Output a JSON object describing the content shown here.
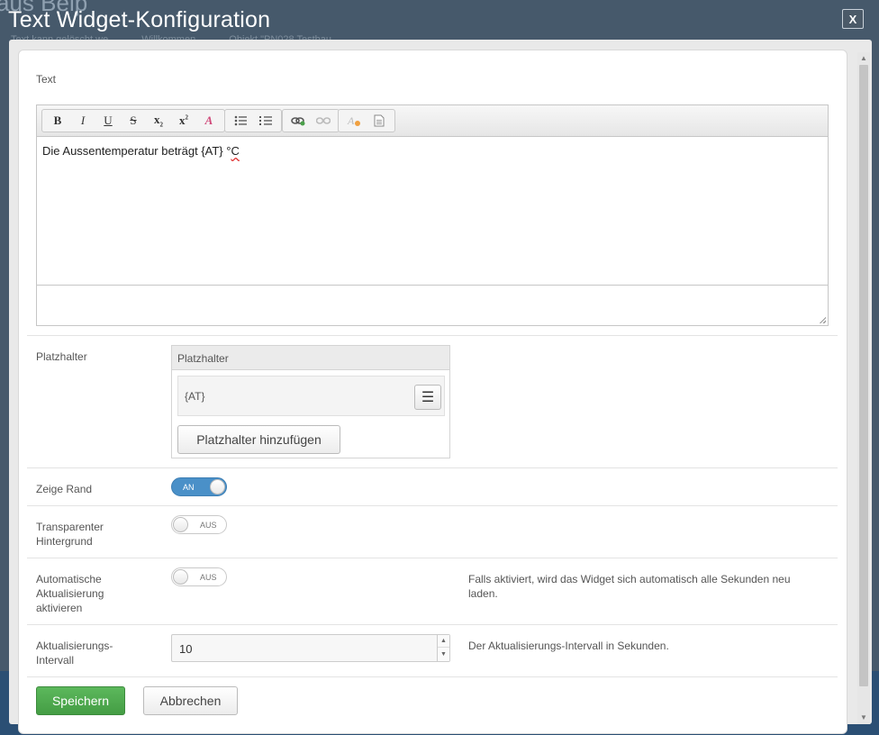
{
  "background": {
    "title": "aus Belp\"",
    "nav": [
      "Text kann gelöscht we",
      "Willkommen",
      "Objekt \"PN028 Testbau"
    ]
  },
  "dialog": {
    "title": "Text Widget-Konfiguration",
    "close_label": "X"
  },
  "text_section": {
    "label": "Text",
    "toolbar": {
      "bold": "B",
      "italic": "I",
      "underline": "U",
      "strike": "S",
      "subscript": "x",
      "superscript": "x",
      "remove_format": "A"
    },
    "content_main": "Die Aussentemperatur beträgt {AT} °",
    "content_unit": "C"
  },
  "placeholder_section": {
    "label": "Platzhalter",
    "panel_header": "Platzhalter",
    "items": [
      {
        "label": "{AT}"
      }
    ],
    "add_button": "Platzhalter hinzufügen"
  },
  "border_section": {
    "label": "Zeige Rand",
    "toggle_text": "AN",
    "state": "on"
  },
  "transparent_section": {
    "label_line1": "Transparenter",
    "label_line2": "Hintergrund",
    "toggle_text": "AUS",
    "state": "off"
  },
  "auto_refresh_section": {
    "label_line1": "Automatische",
    "label_line2": "Aktualisierung",
    "label_line3": "aktivieren",
    "toggle_text": "AUS",
    "state": "off",
    "help_line1": "Falls aktiviert, wird das Widget sich automatisch alle Sekunden neu",
    "help_line2": "laden."
  },
  "interval_section": {
    "label_line1": "Aktualisierungs-",
    "label_line2": "Intervall",
    "value": "10",
    "help": "Der Aktualisierungs-Intervall in Sekunden."
  },
  "footer": {
    "save_label": "Speichern",
    "cancel_label": "Abbrechen"
  },
  "colors": {
    "accent": "#4a90c8",
    "save": "#5cb85c",
    "overlay": "#46596b"
  }
}
